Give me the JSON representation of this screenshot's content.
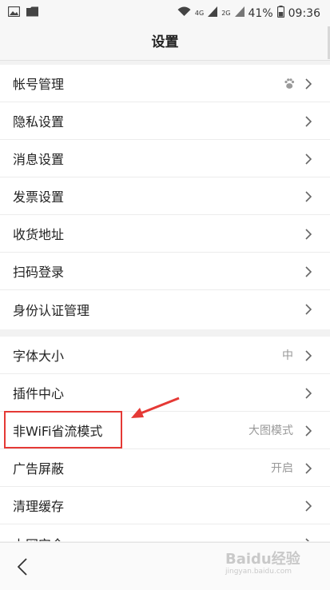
{
  "status_bar": {
    "battery": "41%",
    "time": "09:36",
    "net_4g": "4G",
    "net_2g": "2G",
    "icons": [
      "image-icon",
      "folder-icon",
      "wifi-icon",
      "signal-icon",
      "battery-icon"
    ]
  },
  "header": {
    "title": "设置"
  },
  "groups": [
    {
      "items": [
        {
          "label": "帐号管理",
          "icon": "paw-icon"
        },
        {
          "label": "隐私设置"
        },
        {
          "label": "消息设置"
        },
        {
          "label": "发票设置"
        },
        {
          "label": "收货地址"
        },
        {
          "label": "扫码登录"
        },
        {
          "label": "身份认证管理"
        }
      ]
    },
    {
      "items": [
        {
          "label": "字体大小",
          "value": "中"
        },
        {
          "label": "插件中心"
        },
        {
          "label": "非WiFi省流模式",
          "value": "大图模式"
        },
        {
          "label": "广告屏蔽",
          "value": "开启"
        },
        {
          "label": "清理缓存"
        },
        {
          "label": "上网安全"
        }
      ]
    }
  ],
  "watermark": {
    "line1": "Baidu经验",
    "line2": "jingyan.baidu.com"
  },
  "annotation": {
    "color": "#e53935"
  }
}
